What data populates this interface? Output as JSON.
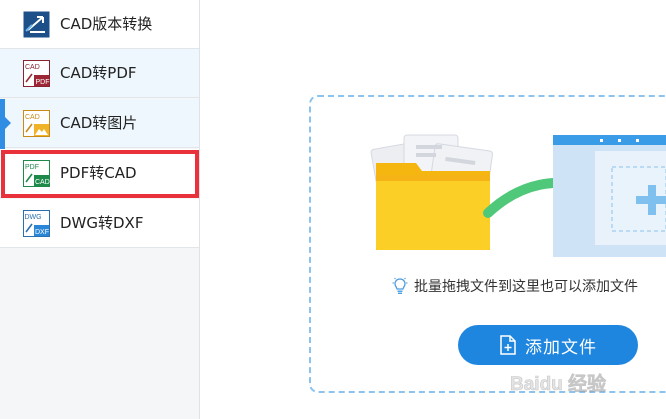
{
  "sidebar": {
    "items": [
      {
        "label": "CAD版本转换",
        "icon": "cad-version-convert-icon"
      },
      {
        "label": "CAD转PDF",
        "icon": "cad-to-pdf-icon",
        "icon_text_top": "CAD",
        "icon_text_bottom": "PDF"
      },
      {
        "label": "CAD转图片",
        "icon": "cad-to-image-icon",
        "icon_text_top": "CAD"
      },
      {
        "label": "PDF转CAD",
        "icon": "pdf-to-cad-icon",
        "icon_text_top": "PDF",
        "icon_text_bottom": "CAD"
      },
      {
        "label": "DWG转DXF",
        "icon": "dwg-to-dxf-icon",
        "icon_text_top": "DWG",
        "icon_text_bottom": "DXF"
      }
    ],
    "active_index": 2,
    "highlighted_index": 3
  },
  "main": {
    "hint": "批量拖拽文件到这里也可以添加文件",
    "add_button_label": "添加文件"
  },
  "watermark": {
    "text": "Baidu 经验"
  },
  "colors": {
    "accent": "#1f86e0",
    "highlight_border": "#e8313a",
    "drop_zone_border": "#8cc3ee",
    "folder": "#f9c51b",
    "arrow": "#4fc879"
  }
}
